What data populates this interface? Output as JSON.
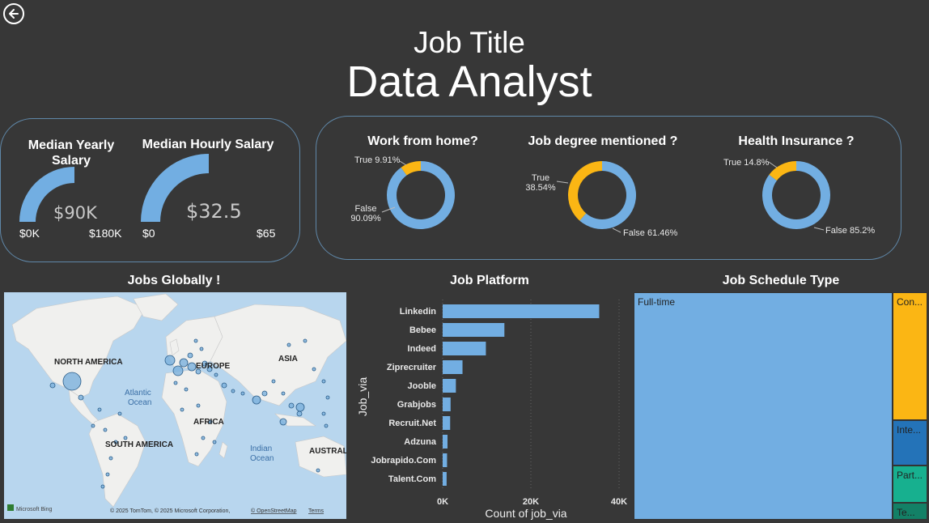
{
  "header": {
    "back_icon": "arrow-left-circle-icon",
    "title_small": "Job Title",
    "title_big": "Data Analyst"
  },
  "salary": {
    "yearly": {
      "title_line1": "Median Yearly",
      "title_line2": "Salary",
      "value": "$90K",
      "min": "$0K",
      "max": "$180K",
      "fill_fraction": 0.5
    },
    "hourly": {
      "title": "Median Hourly Salary",
      "value": "$32.5",
      "min": "$0",
      "max": "$65",
      "fill_fraction": 0.5
    },
    "gauge_color": "#72aee2"
  },
  "donuts": [
    {
      "title": "Work from home?",
      "true_pct": 9.91,
      "true_label": "True 9.91%",
      "false_label_line1": "False",
      "false_label_line2": "90.09%"
    },
    {
      "title": "Job degree mentioned ?",
      "true_pct": 38.54,
      "true_label_line1": "True",
      "true_label_line2": "38.54%",
      "false_label": "False 61.46%"
    },
    {
      "title": "Health Insurance ?",
      "true_pct": 14.8,
      "true_label": "True 14.8%",
      "false_label": "False 85.2%"
    }
  ],
  "colors": {
    "blue": "#72aee2",
    "yellow": "#fbb614",
    "dark_blue": "#2473b8",
    "teal": "#17b08f",
    "dark_teal": "#138066"
  },
  "map": {
    "title": "Jobs Globally !",
    "labels": {
      "north_america": "NORTH AMERICA",
      "europe": "EUROPE",
      "asia": "ASIA",
      "africa": "AFRICA",
      "south_america": "SOUTH AMERICA",
      "australia": "AUSTRAL",
      "atlantic_line1": "Atlantic",
      "atlantic_line2": "Ocean",
      "indian_line1": "Indian",
      "indian_line2": "Ocean"
    },
    "logo_text": "Microsoft Bing",
    "copyright": "© 2025 TomTom, © 2025 Microsoft Corporation,",
    "osm_link": "© OpenStreetMap",
    "terms_link": "Terms"
  },
  "chart_data": {
    "type": "bar",
    "title": "Job Platform",
    "xlabel": "Count of job_via",
    "ylabel": "Job_via",
    "categories": [
      "Linkedin",
      "Bebee",
      "Indeed",
      "Ziprecruiter",
      "Jooble",
      "Grabjobs",
      "Recruit.Net",
      "Adzuna",
      "Jobrapido.Com",
      "Talent.Com"
    ],
    "values": [
      35500,
      14000,
      9800,
      4500,
      3000,
      1800,
      1700,
      1100,
      1000,
      900
    ],
    "xlim": [
      0,
      40000
    ],
    "x_ticks": [
      "0K",
      "20K",
      "40K"
    ],
    "orientation": "horizontal",
    "grid": true
  },
  "treemap": {
    "title": "Job Schedule Type",
    "items": [
      {
        "label": "Full-time",
        "share": 0.89,
        "color": "#72aee2"
      },
      {
        "label": "Con...",
        "share": 0.053,
        "color": "#fbb614"
      },
      {
        "label": "Inte...",
        "share": 0.018,
        "color": "#2473b8"
      },
      {
        "label": "Part...",
        "share": 0.014,
        "color": "#17b08f"
      },
      {
        "label": "Te...",
        "share": 0.006,
        "color": "#138066"
      }
    ]
  }
}
